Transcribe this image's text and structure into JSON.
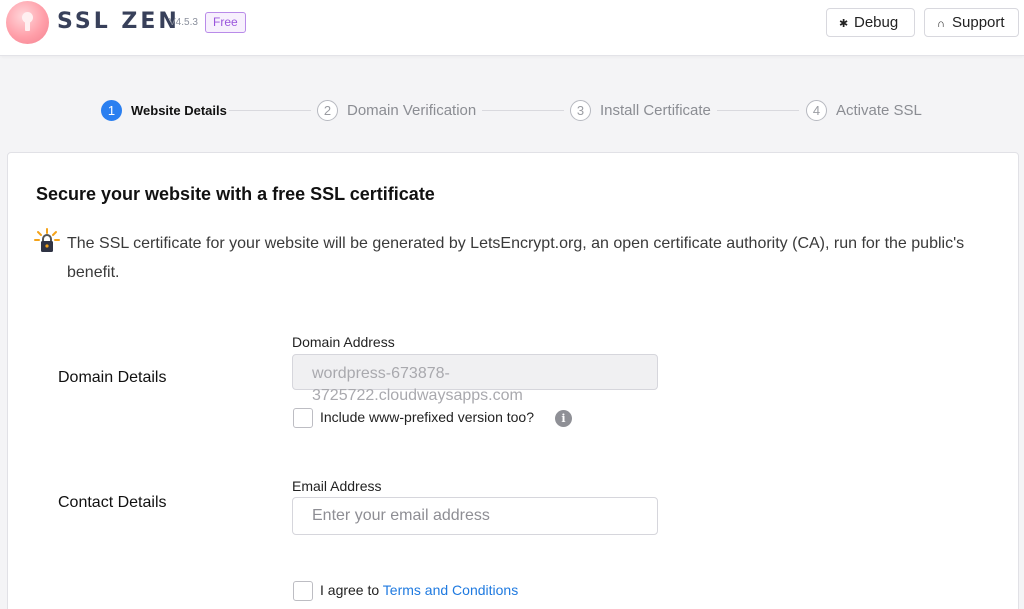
{
  "header": {
    "brand": "SSL ZEN",
    "version": "V4.5.3",
    "badge": "Free",
    "debug_label": "Debug",
    "support_label": "Support"
  },
  "steps": [
    {
      "num": "1",
      "label": "Website Details",
      "active": true
    },
    {
      "num": "2",
      "label": "Domain Verification",
      "active": false
    },
    {
      "num": "3",
      "label": "Install Certificate",
      "active": false
    },
    {
      "num": "4",
      "label": "Activate SSL",
      "active": false
    }
  ],
  "main": {
    "title": "Secure your website with a free SSL certificate",
    "info": "The SSL certificate for your website will be generated by LetsEncrypt.org, an open certificate authority (CA), run for the public's benefit.",
    "domain_section": "Domain Details",
    "domain_label": "Domain Address",
    "domain_value": "wordpress-673878-3725722.cloudwaysapps.com",
    "www_label": "Include www-prefixed version too?",
    "contact_section": "Contact Details",
    "email_label": "Email Address",
    "email_placeholder": "Enter your email address",
    "agree_prefix": "I agree to ",
    "agree_link": "Terms and Conditions"
  },
  "colors": {
    "accent": "#2a7ff0",
    "badge": "#9a55dc",
    "link": "#1f7ae0"
  }
}
